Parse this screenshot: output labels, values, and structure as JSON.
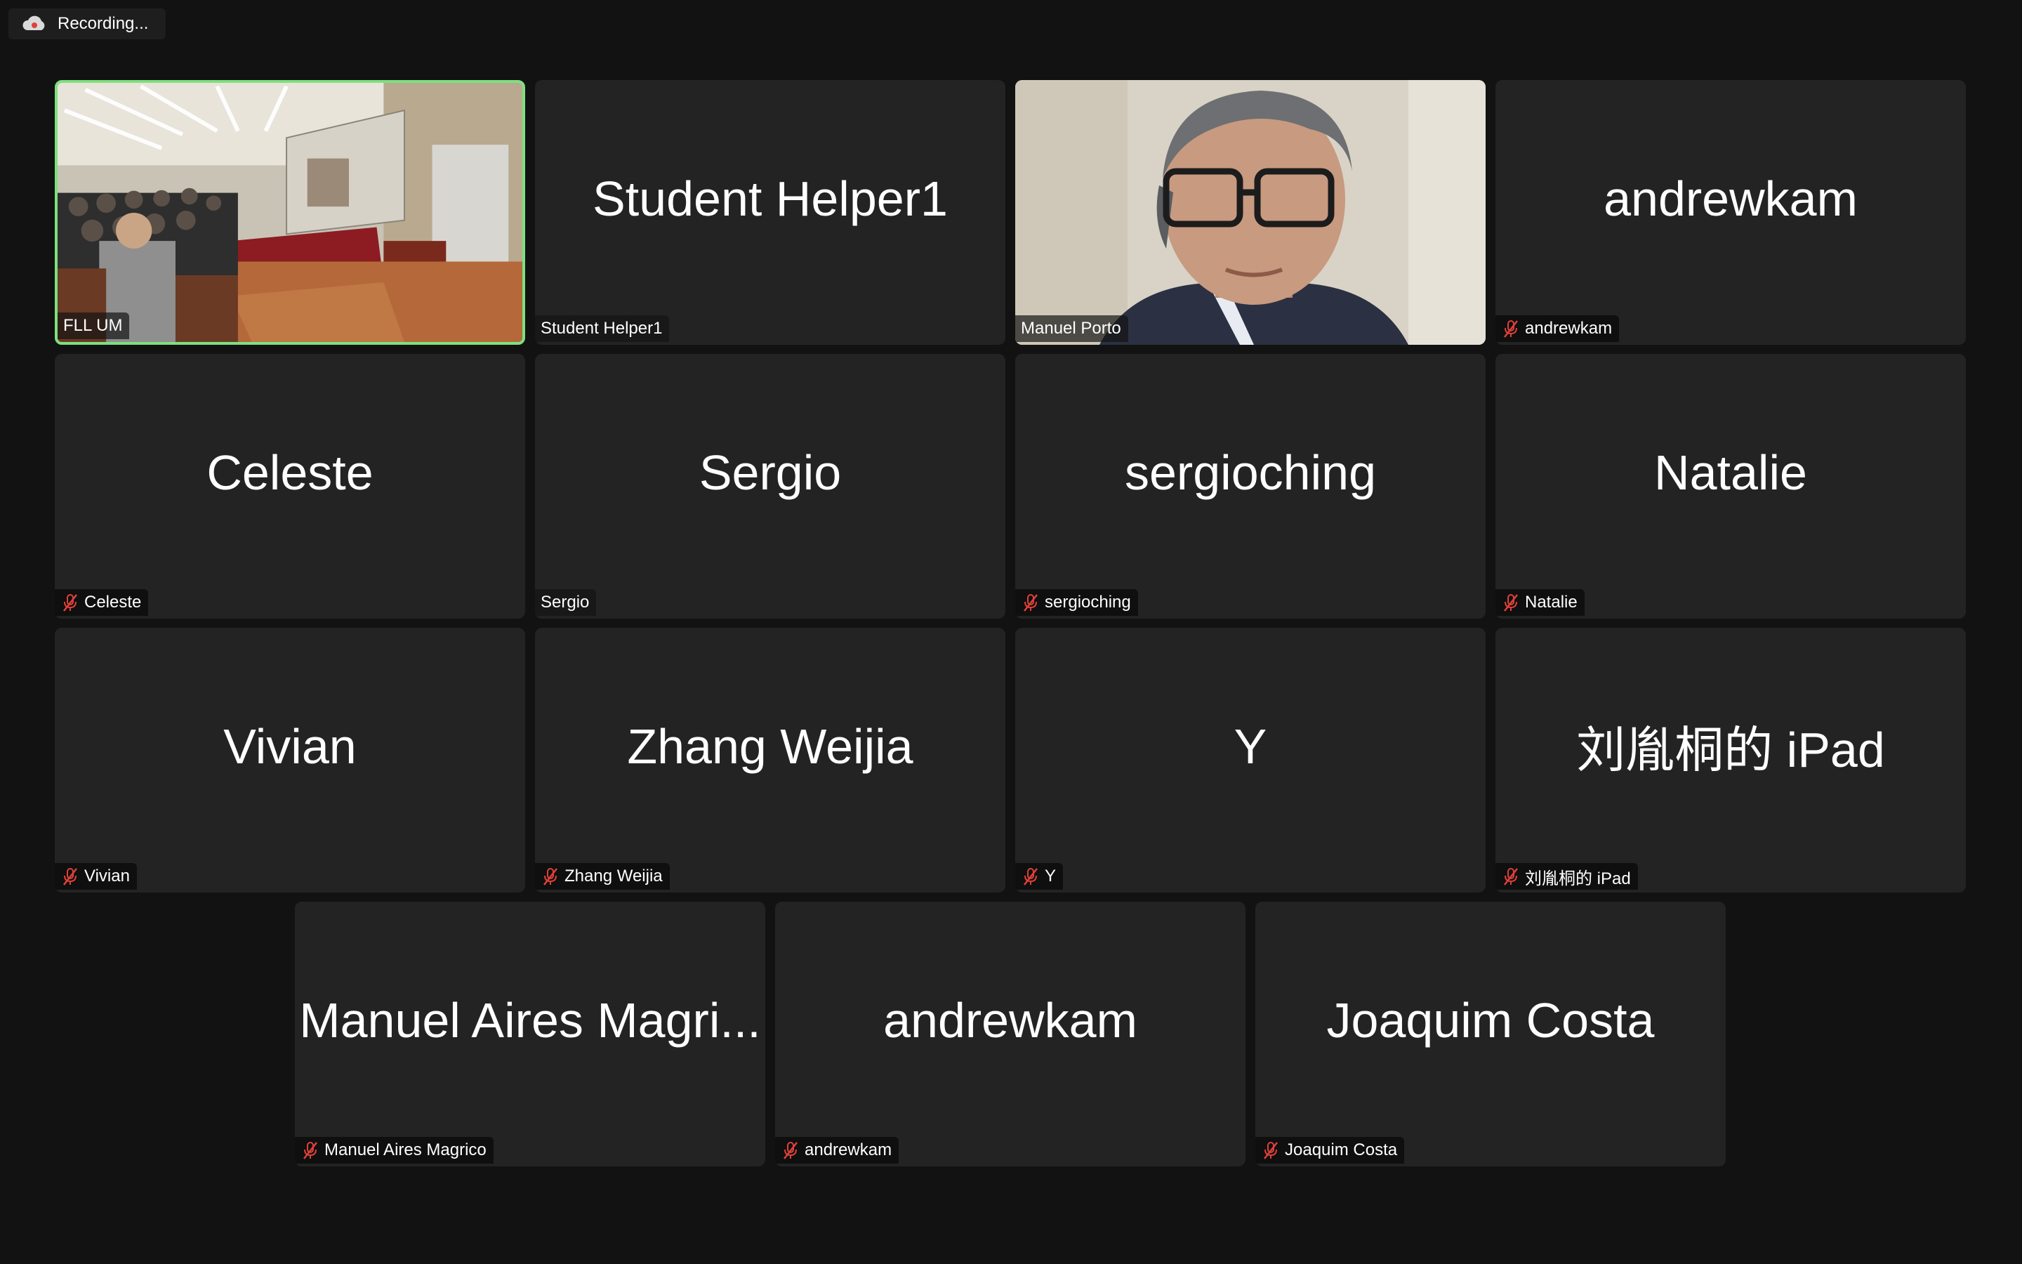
{
  "recording": {
    "label": "Recording...",
    "icon": "cloud-record-icon"
  },
  "tiles": [
    {
      "name": "FLL UM",
      "display": "",
      "muted": false,
      "video": "lecture-hall"
    },
    {
      "name": "Student Helper1",
      "display": "Student Helper1",
      "muted": false,
      "video": ""
    },
    {
      "name": "Manuel Porto",
      "display": "",
      "muted": false,
      "video": "webcam-man"
    },
    {
      "name": "andrewkam",
      "display": "andrewkam",
      "muted": true,
      "video": ""
    },
    {
      "name": "Celeste",
      "display": "Celeste",
      "muted": true,
      "video": ""
    },
    {
      "name": "Sergio",
      "display": "Sergio",
      "muted": false,
      "video": ""
    },
    {
      "name": "sergioching",
      "display": "sergioching",
      "muted": true,
      "video": ""
    },
    {
      "name": "Natalie",
      "display": "Natalie",
      "muted": true,
      "video": ""
    },
    {
      "name": "Vivian",
      "display": "Vivian",
      "muted": true,
      "video": ""
    },
    {
      "name": "Zhang Weijia",
      "display": "Zhang Weijia",
      "muted": true,
      "video": ""
    },
    {
      "name": "Y",
      "display": "Y",
      "muted": true,
      "video": ""
    },
    {
      "name": "刘胤桐的 iPad",
      "display": "刘胤桐的 iPad",
      "muted": true,
      "video": ""
    },
    {
      "name": "Manuel Aires Magrico",
      "display": "Manuel Aires Magri...",
      "muted": true,
      "video": ""
    },
    {
      "name": "andrewkam",
      "display": "andrewkam",
      "muted": true,
      "video": ""
    },
    {
      "name": "Joaquim Costa",
      "display": "Joaquim Costa",
      "muted": true,
      "video": ""
    }
  ],
  "colors": {
    "background": "#121212",
    "tile": "#232323",
    "active_border": "#7ee07e",
    "mic_off": "#e0403a"
  }
}
